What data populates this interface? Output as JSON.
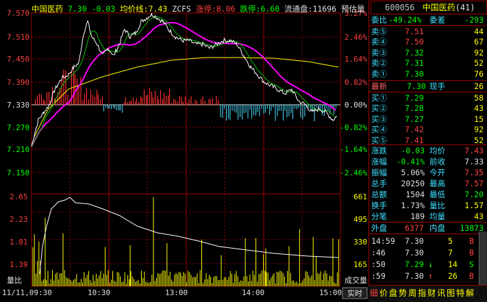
{
  "header": {
    "name": "中国医药",
    "price": "7.30",
    "change": "-0.03",
    "avg_label": "均价线:7.43",
    "zcfs": "ZCFS",
    "limit_up": "涨停:8.06",
    "limit_down": "跌停:6.60",
    "float": "流通盘:11696",
    "forecast": "预估量"
  },
  "axes": {
    "price_left": [
      "7.570",
      "7.510",
      "7.450",
      "7.390",
      "7.330",
      "7.270",
      "7.210",
      "7.150"
    ],
    "pct_right": [
      "3.27%",
      "2.46%",
      "1.64%",
      "0.82%",
      "0.00%",
      "-0.82%",
      "-1.64%",
      "-2.46%"
    ],
    "vol_left": [
      "2.65",
      "2.23",
      "1.81",
      "1.39"
    ],
    "vol_right": [
      "661",
      "495",
      "330",
      "165"
    ],
    "vol_title": "量比",
    "vol_unit": "成交量",
    "time_labels": [
      "11/11,09:30",
      "10:30",
      "13:00",
      "14:00",
      "15:00"
    ],
    "realtime_btn": "实时"
  },
  "colors": {
    "bg": "#000000",
    "grid": "#a00000",
    "price": "#ffffff",
    "avg": "#ffff00",
    "ma": "#ff00ff",
    "ma2": "#00c000",
    "up": "#ff3030",
    "down": "#40c0e0"
  },
  "panel": {
    "code": "600056",
    "name": "中国医药",
    "count": "(41)",
    "weibi_label": "委比",
    "weibi": "-49.24%",
    "weicha_label": "委差",
    "weicha": "-293",
    "asks": [
      {
        "label": "卖⑤",
        "price": "7.51",
        "vol": "44"
      },
      {
        "label": "卖④",
        "price": "7.50",
        "vol": "67"
      },
      {
        "label": "卖③",
        "price": "7.32",
        "vol": "92"
      },
      {
        "label": "卖②",
        "price": "7.31",
        "vol": "52"
      },
      {
        "label": "卖①",
        "price": "7.30",
        "vol": "76"
      }
    ],
    "latest_label": "最新",
    "latest": "7.30",
    "xianshou_label": "现手",
    "xianshou": "26",
    "bids": [
      {
        "label": "买①",
        "price": "7.29",
        "vol": "58"
      },
      {
        "label": "买②",
        "price": "7.28",
        "vol": "43"
      },
      {
        "label": "买③",
        "price": "7.27",
        "vol": "15"
      },
      {
        "label": "买④",
        "price": "7.42",
        "vol": "92"
      },
      {
        "label": "买⑤",
        "price": "7.41",
        "vol": "52"
      }
    ],
    "stats": [
      {
        "l1": "涨跌",
        "v1": "-0.03",
        "l2": "均价",
        "v2": "7.43"
      },
      {
        "l1": "涨幅",
        "v1": "-0.41%",
        "l2": "前收",
        "v2": "7.33"
      },
      {
        "l1": "振幅",
        "v1": "5.06%",
        "l2": "今开",
        "v2": "7.35"
      },
      {
        "l1": "总手",
        "v1": "20250",
        "l2": "最高",
        "v2": "7.57"
      },
      {
        "l1": "总额",
        "v1": "1504",
        "l2": "最低",
        "v2": "7.20"
      },
      {
        "l1": "换手",
        "v1": "1.73%",
        "l2": "量比",
        "v2": "1.57"
      },
      {
        "l1": "分笔",
        "v1": "189",
        "l2": "均量",
        "v2": "43"
      }
    ],
    "outer_label": "外盘",
    "outer": "6377",
    "inner_label": "内盘",
    "inner": "13873",
    "ticks": [
      {
        "time": "14:59",
        "price": "7.30",
        "arrow": "",
        "vol": "5",
        "side": "B"
      },
      {
        "time": ":46",
        "price": "7.30",
        "arrow": "",
        "vol": "7",
        "side": "B"
      },
      {
        "time": ":50",
        "price": "7.29",
        "arrow": "↓",
        "vol": "14",
        "side": "S"
      },
      {
        "time": ":59",
        "price": "7.30",
        "arrow": "↑",
        "vol": "26",
        "side": "B"
      }
    ],
    "tabs": [
      "细",
      "价",
      "盘",
      "势",
      "周",
      "指",
      "财",
      "讯",
      "图",
      "特",
      "解"
    ]
  }
}
